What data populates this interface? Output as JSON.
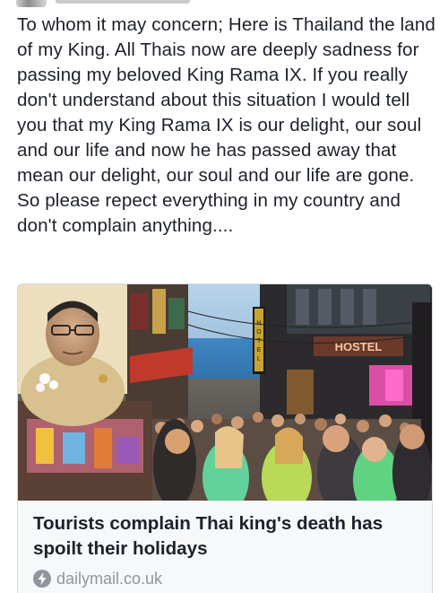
{
  "post": {
    "text": "To whom it may concern; Here is Thailand the land of my King. All Thais now are deeply sadness for passing my beloved King Rama IX. If you really don't understand about this situation I would tell you that my King Rama IX is our delight, our soul and our life and now he has passed away that mean our delight, our soul and our life are gone. So please repect everything in my country and don't complain anything...."
  },
  "link_card": {
    "image": {
      "sign_text": "HOSTEL",
      "vertical_sign_text": "HOTEL"
    },
    "headline": "Tourists complain Thai king's death has spoilt their holidays",
    "source_icon": "lightning-bolt-icon",
    "domain": "dailymail.co.uk"
  },
  "colors": {
    "text": "#1d2129",
    "card_background": "#f7f8fa",
    "card_border": "#d6d8dc",
    "domain_text": "#90949c"
  }
}
